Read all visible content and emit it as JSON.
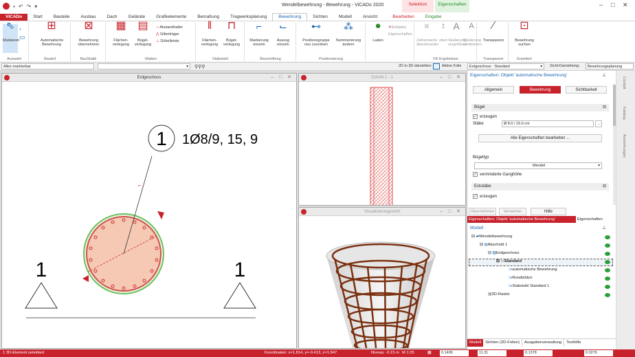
{
  "app": {
    "title": "Wendelbewehrung - Bewehrung - ViCADo 2020"
  },
  "context_tabs": {
    "selection": "Selektion",
    "properties": "Eigenschaften",
    "edit": "Bearbeiten",
    "input": "Eingabe"
  },
  "tabs": [
    "ViCADo",
    "Start",
    "Bauteile",
    "Ausbau",
    "Dach",
    "Gelände",
    "Grafikelemente",
    "Bemaßung",
    "Tragwerksplanung",
    "Bewehrung",
    "Sichten",
    "Modell",
    "Ansicht"
  ],
  "ribbon": {
    "markieren": "Markieren",
    "auswahl": "Auswahl",
    "auto_bew": "Automatische Bewehrung",
    "bauteil": "Bauteil",
    "bew_uebern": "Bewehrung übernehmen",
    "baustatik": "BauStatik",
    "flaechenverlegung": "Flächen-verlegung",
    "buegelverlegung": "Bügel-verlegung",
    "abstandhalter": "Abstandhalter",
    "gittertraeger": "Gitterträger",
    "duebelleiste": "Dübelleiste",
    "matten": "Matten",
    "flaechen2": "Flächen-verlegung",
    "buegel2": "Bügel-verlegung",
    "stabstahl": "Stabstahl",
    "markierung_einzeln": "Markierung einzeln",
    "auszug_einzeln": "Auszug einzeln",
    "beschriftung": "Beschriftung",
    "positionsgruppe": "Positionsgruppe neu zuordnen",
    "nummerierung": "Nummerierung ändern",
    "positionierung": "Positionierung",
    "laden": "Laden",
    "entladen": "Entladen",
    "eigenschaften": "Eigenschaften",
    "zahlenwerte": "Zahlenwerte übereinander",
    "oben": "oben",
    "skalierung_vergr": "Skalierung vergrößern",
    "skalierung_verkl": "Skalierung verkleinern",
    "fe_ergebnisse": "FE-Ergebnisse",
    "transparenz": "Transparenz",
    "transparent_label": "Transparent",
    "bew_suchen": "Bewehrung suchen",
    "erweitert": "Erweitert"
  },
  "toolbar2": {
    "filter": "Alles markierbar",
    "mode3d": "2D in 3D darstellen:",
    "aktive_folie": "Aktive Folie",
    "folie_value": "Erdgeschoss : Standard",
    "sicht_label": "Sicht-Darstellung:",
    "sicht_value": "Bewehrungsplanung"
  },
  "windows": {
    "erdgeschoss": {
      "title": "Erdgeschoss",
      "label_pos": "1",
      "label_text": "1Ø8/9, 15, 9",
      "section_left": "1",
      "section_right": "1"
    },
    "schnitt": {
      "title": "Schnitt 1 - 1"
    },
    "visual": {
      "title": "Visualisierungssicht"
    }
  },
  "props": {
    "header": "Eigenschaften: Objekt 'automatische Bewehrung'",
    "tabs": [
      "Allgemein",
      "Bewehrung",
      "Sichtbarkeit"
    ],
    "buegel_section": "Bügel",
    "erzeugen": "erzeugen",
    "staebe_label": "Stäbe",
    "staebe_value": "Ø 8.0 / 15.0 cm",
    "alle_eig": "Alle Eigenschaften bearbeiten ...",
    "buegeltyp": "Bügeltyp",
    "wendel": "Wendel",
    "verminderte": "verminderte Ganghöhe",
    "eckstaebe": "Eckstäbe",
    "erzeugen2": "erzeugen",
    "uebernehmen": "Übernehmen",
    "verwerfen": "Verwerfen",
    "hilfe": "Hilfe",
    "bottom_tab_active": "Eigenschaften: Objekt 'automatische Bewehrung'",
    "bottom_tab_2": "Eigenschaften"
  },
  "model": {
    "title": "Modell",
    "items": [
      {
        "label": "Wendelbewehrung",
        "level": 0,
        "icon": "folder-icon"
      },
      {
        "label": "Abschnitt 1",
        "level": 1,
        "icon": "section-icon"
      },
      {
        "label": "Erdgeschoss",
        "level": 2,
        "icon": "floor-icon"
      },
      {
        "label": "Standard",
        "level": 3,
        "icon": "layer-icon"
      },
      {
        "label": "automatische Bewehrung",
        "level": 4,
        "icon": "list-icon"
      },
      {
        "label": "Rundstütze",
        "level": 4,
        "icon": "list-icon"
      },
      {
        "label": "Stabstahl Standard 1",
        "level": 4,
        "icon": "list-icon"
      },
      {
        "label": "3D-Raster",
        "level": 2,
        "icon": "grid-icon"
      }
    ],
    "bottom_tabs": [
      "Modell",
      "Sichten (2D-Folien)",
      "Ausgabenverwaltung",
      "Texthilfe"
    ]
  },
  "sidetabs": [
    "Cockpit",
    "Katalog",
    "Anmerkungen"
  ],
  "status": {
    "left": "1 3D-Element selektiert",
    "coords": "Koordinaten: x=1.814, y=-0.413, z=1.947",
    "niveau": "Niveau: -0.15 m",
    "scale": "M 1:25",
    "f1": "0.1406",
    "f2": "11.31",
    "f3": "0.1378",
    "f4": "0.0276"
  },
  "colors": {
    "accent": "#c8232c",
    "link": "#1a66b3",
    "rebar": "#e06060",
    "concrete_fill": "#f5c9b3",
    "ring": "#6fbf5c"
  }
}
